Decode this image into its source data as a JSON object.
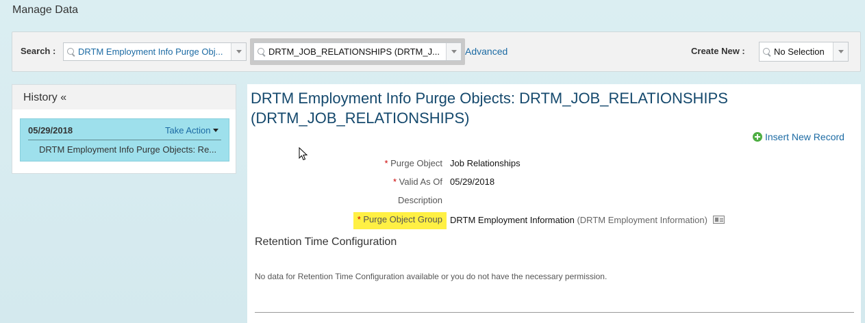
{
  "page": {
    "title": "Manage Data"
  },
  "search": {
    "label": "Search :",
    "type_value": "DRTM Employment Info Purge Obj...",
    "object_value": "DRTM_JOB_RELATIONSHIPS (DRTM_J...",
    "advanced_link": "Advanced"
  },
  "create_new": {
    "label": "Create New :",
    "value": "No Selection"
  },
  "history": {
    "title": "History «",
    "entries": [
      {
        "date": "05/29/2018",
        "action": "Take Action",
        "description": "DRTM Employment Info Purge Objects: Re..."
      }
    ]
  },
  "record": {
    "title": "DRTM Employment Info Purge Objects: DRTM_JOB_RELATIONSHIPS (DRTM_JOB_RELATIONSHIPS)",
    "insert_button": "Insert New Record",
    "required_marker": "*",
    "fields": [
      {
        "label": "Purge Object",
        "required": true,
        "value": "Job Relationships"
      },
      {
        "label": "Valid As Of",
        "required": true,
        "value": "05/29/2018"
      },
      {
        "label": "Description",
        "required": false,
        "value": ""
      },
      {
        "label": "Purge Object Group",
        "required": true,
        "value": "DRTM Employment Information",
        "secondary": "(DRTM Employment Information)"
      }
    ],
    "retention": {
      "title": "Retention Time Configuration",
      "empty_message": "No data for Retention Time Configuration available or you do not have the necessary permission."
    }
  },
  "colors": {
    "link": "#1b6aa3",
    "title": "#15496d",
    "history_card": "#9ee0ec",
    "highlight": "#fff044",
    "required": "#cc0000"
  }
}
